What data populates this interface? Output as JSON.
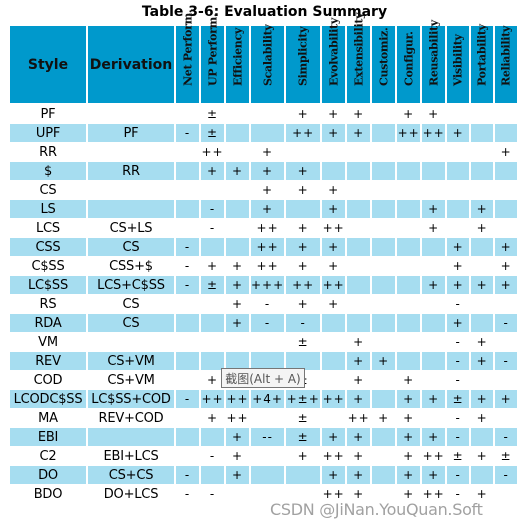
{
  "title": "Table 3-6: Evaluation Summary",
  "columns": {
    "style": "Style",
    "derivation": "Derivation",
    "properties": [
      "Net Perform.",
      "UP Perform.",
      "Efficiency",
      "Scalability",
      "Simplicity",
      "Evolvability",
      "Extensibility",
      "Customiz.",
      "Configur.",
      "Reusability",
      "Visibility",
      "Portability",
      "Reliability"
    ]
  },
  "rows": [
    {
      "style": "PF",
      "derivation": "",
      "values": [
        "",
        "±",
        "",
        "",
        "+",
        "+",
        "+",
        "",
        "+",
        "+",
        "",
        "",
        ""
      ]
    },
    {
      "style": "UPF",
      "derivation": "PF",
      "values": [
        "-",
        "±",
        "",
        "",
        "++",
        "+",
        "+",
        "",
        "++",
        "++",
        "+",
        "",
        ""
      ]
    },
    {
      "style": "RR",
      "derivation": "",
      "values": [
        "",
        "++",
        "",
        "+",
        "",
        "",
        "",
        "",
        "",
        "",
        "",
        "",
        "+"
      ]
    },
    {
      "style": "$",
      "derivation": "RR",
      "values": [
        "",
        "+",
        "+",
        "+",
        "+",
        "",
        "",
        "",
        "",
        "",
        "",
        "",
        ""
      ]
    },
    {
      "style": "CS",
      "derivation": "",
      "values": [
        "",
        "",
        "",
        "+",
        "+",
        "+",
        "",
        "",
        "",
        "",
        "",
        "",
        ""
      ]
    },
    {
      "style": "LS",
      "derivation": "",
      "values": [
        "",
        "-",
        "",
        "+",
        "",
        "+",
        "",
        "",
        "",
        "+",
        "",
        "+",
        ""
      ]
    },
    {
      "style": "LCS",
      "derivation": "CS+LS",
      "values": [
        "",
        "-",
        "",
        "++",
        "+",
        "++",
        "",
        "",
        "",
        "+",
        "",
        "+",
        ""
      ]
    },
    {
      "style": "CSS",
      "derivation": "CS",
      "values": [
        "-",
        "",
        "",
        "++",
        "+",
        "+",
        "",
        "",
        "",
        "",
        "+",
        "",
        "+"
      ]
    },
    {
      "style": "C$SS",
      "derivation": "CSS+$",
      "values": [
        "-",
        "+",
        "+",
        "++",
        "+",
        "+",
        "",
        "",
        "",
        "",
        "+",
        "",
        "+"
      ]
    },
    {
      "style": "LC$SS",
      "derivation": "LCS+C$SS",
      "values": [
        "-",
        "±",
        "+",
        "+++",
        "++",
        "++",
        "",
        "",
        "",
        "+",
        "+",
        "+",
        "+"
      ]
    },
    {
      "style": "RS",
      "derivation": "CS",
      "values": [
        "",
        "",
        "+",
        "-",
        "+",
        "+",
        "",
        "",
        "",
        "",
        "-",
        "",
        ""
      ]
    },
    {
      "style": "RDA",
      "derivation": "CS",
      "values": [
        "",
        "",
        "+",
        "-",
        "-",
        "",
        "",
        "",
        "",
        "",
        "+",
        "",
        "-"
      ]
    },
    {
      "style": "VM",
      "derivation": "",
      "values": [
        "",
        "",
        "",
        "",
        "±",
        "",
        "+",
        "",
        "",
        "",
        "-",
        "+",
        ""
      ]
    },
    {
      "style": "REV",
      "derivation": "CS+VM",
      "values": [
        "",
        "",
        "",
        "",
        "",
        "",
        "+",
        "+",
        "",
        "",
        "-",
        "+",
        "-"
      ]
    },
    {
      "style": "COD",
      "derivation": "CS+VM",
      "values": [
        "",
        "+",
        "+",
        "+",
        "±",
        "",
        "+",
        "",
        "+",
        "",
        "-",
        "",
        ""
      ]
    },
    {
      "style": "LCODC$SS",
      "derivation": "LC$SS+COD",
      "values": [
        "-",
        "++",
        "++",
        "+4+",
        "+±+",
        "++",
        "+",
        "",
        "+",
        "+",
        "±",
        "+",
        "+"
      ]
    },
    {
      "style": "MA",
      "derivation": "REV+COD",
      "values": [
        "",
        "+",
        "++",
        "",
        "±",
        "",
        "++",
        "+",
        "+",
        "",
        "-",
        "+",
        ""
      ]
    },
    {
      "style": "EBI",
      "derivation": "",
      "values": [
        "",
        "",
        "+",
        "--",
        "±",
        "+",
        "+",
        "",
        "+",
        "+",
        "-",
        "",
        "-"
      ]
    },
    {
      "style": "C2",
      "derivation": "EBI+LCS",
      "values": [
        "",
        "-",
        "+",
        "",
        "+",
        "++",
        "+",
        "",
        "+",
        "++",
        "±",
        "+",
        "±"
      ]
    },
    {
      "style": "DO",
      "derivation": "CS+CS",
      "values": [
        "-",
        "",
        "+",
        "",
        "",
        "+",
        "+",
        "",
        "+",
        "+",
        "-",
        "",
        "-"
      ]
    },
    {
      "style": "BDO",
      "derivation": "DO+LCS",
      "values": [
        "-",
        "-",
        "",
        "",
        "",
        "++",
        "+",
        "",
        "+",
        "++",
        "-",
        "+",
        ""
      ]
    }
  ],
  "tooltip": "截图(Alt + A)",
  "watermark": "CSDN @JiNan.YouQuan.Soft",
  "colors": {
    "header_bg": "#0099CC",
    "alt_row_bg": "#A6DDF0"
  }
}
